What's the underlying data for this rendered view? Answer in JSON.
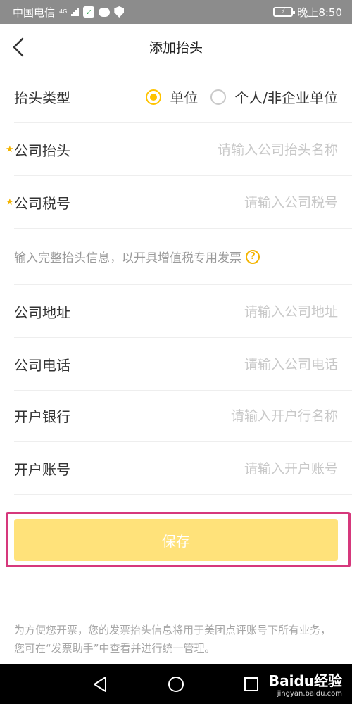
{
  "status_bar": {
    "carrier": "中国电信",
    "network": "4G",
    "time": "晚上8:50"
  },
  "header": {
    "title": "添加抬头"
  },
  "form": {
    "type_row": {
      "label": "抬头类型",
      "options": [
        "单位",
        "个人/非企业单位"
      ],
      "selected": "单位"
    },
    "company_name": {
      "label": "公司抬头",
      "placeholder": "请输入公司抬头名称",
      "value": "",
      "required": true
    },
    "tax_id": {
      "label": "公司税号",
      "placeholder": "请输入公司税号",
      "value": "",
      "required": true
    },
    "note": "输入完整抬头信息，以开具增值税专用发票",
    "address": {
      "label": "公司地址",
      "placeholder": "请输入公司地址",
      "value": ""
    },
    "phone": {
      "label": "公司电话",
      "placeholder": "请输入公司电话",
      "value": ""
    },
    "bank": {
      "label": "开户银行",
      "placeholder": "请输入开户行名称",
      "value": ""
    },
    "account": {
      "label": "开户账号",
      "placeholder": "请输入开户账号",
      "value": ""
    }
  },
  "save_label": "保存",
  "footer_note": "为方便您开票，您的发票抬头信息将用于美团点评账号下所有业务，您可在“发票助手”中查看并进行统一管理。",
  "watermark": {
    "main": "Baidu经验",
    "sub": "jingyan.baidu.com"
  },
  "colors": {
    "accent": "#ffc300",
    "save_button": "#ffe27a",
    "highlight_frame": "#d6387c"
  }
}
